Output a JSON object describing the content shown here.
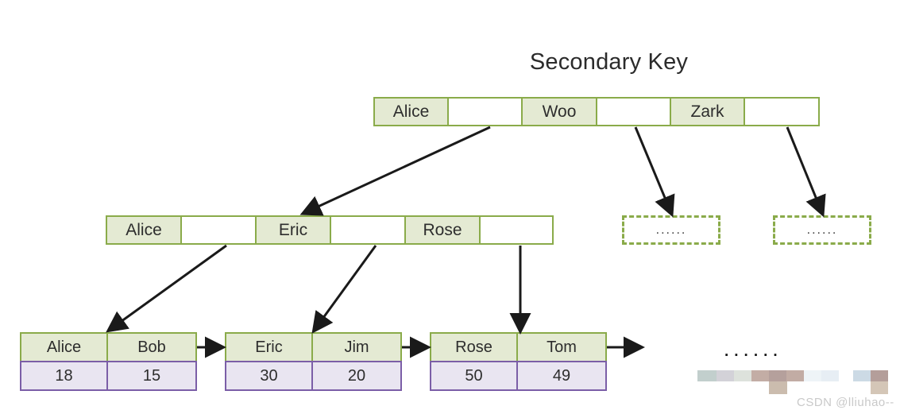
{
  "title": "Secondary Key",
  "colors": {
    "node_border_green": "#8aab4a",
    "key_fill_green": "#e4ead3",
    "pointer_fill_white": "#ffffff",
    "leaf_value_border_purple": "#7b5ea7",
    "leaf_value_fill_lavender": "#e9e5f1",
    "arrow_black": "#1a1a1a",
    "watermark_gray": "#c9c9c9"
  },
  "root_node": {
    "cells": [
      {
        "label": "Alice",
        "type": "key"
      },
      {
        "label": "",
        "type": "pointer"
      },
      {
        "label": "Woo",
        "type": "key"
      },
      {
        "label": "",
        "type": "pointer"
      },
      {
        "label": "Zark",
        "type": "key"
      },
      {
        "label": "",
        "type": "pointer"
      }
    ]
  },
  "internal_node": {
    "cells": [
      {
        "label": "Alice",
        "type": "key"
      },
      {
        "label": "",
        "type": "pointer"
      },
      {
        "label": "Eric",
        "type": "key"
      },
      {
        "label": "",
        "type": "pointer"
      },
      {
        "label": "Rose",
        "type": "key"
      },
      {
        "label": "",
        "type": "pointer"
      }
    ]
  },
  "placeholder_boxes": [
    {
      "label": "......"
    },
    {
      "label": "......"
    }
  ],
  "leaf_nodes": [
    {
      "names": [
        "Alice",
        "Bob"
      ],
      "values": [
        "18",
        "15"
      ]
    },
    {
      "names": [
        "Eric",
        "Jim"
      ],
      "values": [
        "30",
        "20"
      ]
    },
    {
      "names": [
        "Rose",
        "Tom"
      ],
      "values": [
        "50",
        "49"
      ]
    }
  ],
  "trailing_ellipsis": "......",
  "watermark": "CSDN @lliuhao--"
}
